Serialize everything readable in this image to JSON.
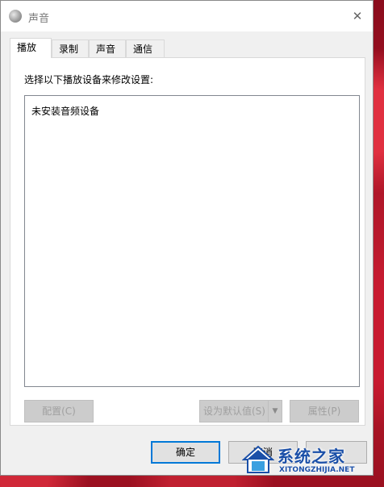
{
  "window": {
    "title": "声音",
    "close_glyph": "✕"
  },
  "tabs": [
    {
      "label": "播放",
      "active": true
    },
    {
      "label": "录制",
      "active": false
    },
    {
      "label": "声音",
      "active": false
    },
    {
      "label": "通信",
      "active": false
    }
  ],
  "panel": {
    "instruction": "选择以下播放设备来修改设置:",
    "empty_message": "未安装音频设备"
  },
  "buttons": {
    "configure": "配置(C)",
    "set_default": "设为默认值(S)",
    "properties": "属性(P)",
    "ok": "确定",
    "cancel": "取消",
    "apply": ""
  },
  "watermark": {
    "title": "系统之家",
    "subtitle": "XITONGZHIJIA.NET",
    "brand_color": "#1a4fa8"
  },
  "icons": {
    "title_icon": "speaker-icon",
    "close": "close-icon",
    "dropdown": "chevron-down-icon"
  }
}
